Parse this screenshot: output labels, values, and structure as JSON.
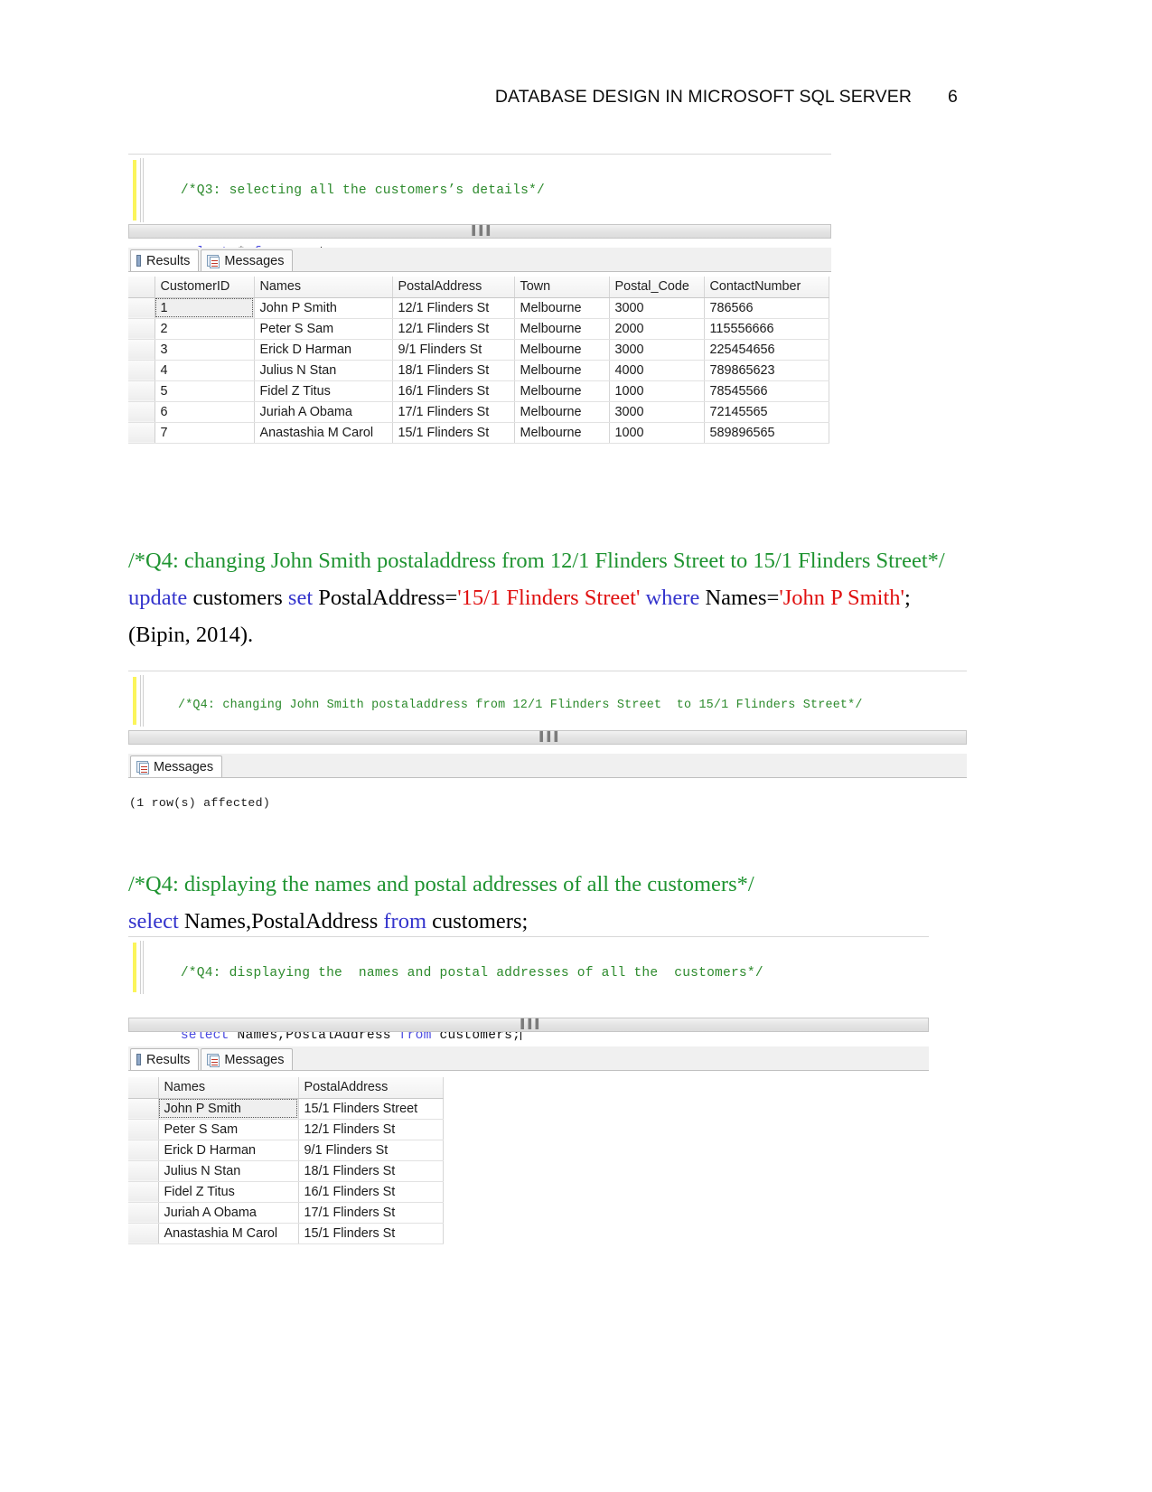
{
  "header": {
    "title": "DATABASE DESIGN IN MICROSOFT SQL SERVER",
    "page_number": "6"
  },
  "colors": {
    "comment_green": "#2c8a2c",
    "keyword_blue": "#4a4ae0",
    "string_red": "#d01818",
    "prose_green": "#1f9431",
    "prose_blue": "#3333cc",
    "prose_red": "#e01010",
    "highlight_yellow": "#fbf55b"
  },
  "editor_q3": {
    "line1_comment": "/*Q3: selecting all the customers’s details*/",
    "line2": {
      "kw_select": "select",
      "star": " * ",
      "kw_from": "from",
      "table": " customers;"
    },
    "scroll_grip": "▐▐▐"
  },
  "results_tabs_1": {
    "results_label": "Results",
    "messages_label": "Messages"
  },
  "grid_customers": {
    "columns": [
      "CustomerID",
      "Names",
      "PostalAddress",
      "Town",
      "Postal_Code",
      "ContactNumber"
    ],
    "rows": [
      [
        "1",
        "John P Smith",
        "12/1 Flinders St",
        "Melbourne",
        "3000",
        "786566"
      ],
      [
        "2",
        "Peter S Sam",
        "12/1 Flinders St",
        "Melbourne",
        "2000",
        "115556666"
      ],
      [
        "3",
        "Erick D Harman",
        "9/1 Flinders St",
        "Melbourne",
        "3000",
        "225454656"
      ],
      [
        "4",
        "Julius N Stan",
        "18/1 Flinders St",
        "Melbourne",
        "4000",
        "789865623"
      ],
      [
        "5",
        "Fidel Z Titus",
        "16/1 Flinders St",
        "Melbourne",
        "1000",
        "78545566"
      ],
      [
        "6",
        "Juriah A Obama",
        "17/1 Flinders St",
        "Melbourne",
        "3000",
        "72145565"
      ],
      [
        "7",
        "Anastashia M Carol",
        "15/1 Flinders St",
        "Melbourne",
        "1000",
        "589896565"
      ]
    ]
  },
  "prose_q4_update": {
    "comment": "/*Q4: changing John Smith postaladdress from 12/1 Flinders Street  to 15/1 Flinders Street*/",
    "kw_update": "update",
    "t_customers": " customers ",
    "kw_set": "set",
    "t_postaladdress": " PostalAddress=",
    "str_address": "'15/1 Flinders Street'",
    "kw_where": " where",
    "t_names": " Names=",
    "str_name": "'John P Smith'",
    "t_semicolon": ";",
    "citation": " (Bipin, 2014)."
  },
  "editor_q4_update": {
    "line1_comment": "/*Q4: changing John Smith postaladdress from 12/1 Flinders Street  to 15/1 Flinders Street*/",
    "line2": {
      "kw_update": "update",
      "t_customers": " customers ",
      "kw_set": "set",
      "t_postaladdress": " PostalAddress=",
      "str_address": "'15/1 Flinders Street'",
      "kw_where": " where",
      "t_names": " Names=",
      "str_name": "'John P Smith'",
      "t_semicolon": ";"
    },
    "scroll_grip": "▐▐▐"
  },
  "messages_tab_2": {
    "messages_label": "Messages"
  },
  "messages_output": {
    "text": "(1 row(s) affected)"
  },
  "prose_q4_select": {
    "comment": "/*Q4: displaying the  names and postal addresses of all the  customers*/",
    "kw_select": "select",
    "t_columns": " Names,PostalAddress ",
    "kw_from": "from",
    "t_table": " customers;"
  },
  "editor_q4_select": {
    "line1_comment": "/*Q4: displaying the  names and postal addresses of all the  customers*/",
    "line2": {
      "kw_select": "select",
      "t_columns": " Names,PostalAddress ",
      "kw_from": "from",
      "t_table": " customers;"
    },
    "scroll_grip": "▐▐▐"
  },
  "results_tabs_2": {
    "results_label": "Results",
    "messages_label": "Messages"
  },
  "grid_names_addresses": {
    "columns": [
      "Names",
      "PostalAddress"
    ],
    "rows": [
      [
        "John P Smith",
        "15/1 Flinders Street"
      ],
      [
        "Peter S Sam",
        "12/1 Flinders St"
      ],
      [
        "Erick D Harman",
        "9/1 Flinders St"
      ],
      [
        "Julius N Stan",
        "18/1 Flinders St"
      ],
      [
        "Fidel Z Titus",
        "16/1 Flinders St"
      ],
      [
        "Juriah A Obama",
        "17/1 Flinders St"
      ],
      [
        "Anastashia M Carol",
        "15/1 Flinders St"
      ]
    ]
  }
}
